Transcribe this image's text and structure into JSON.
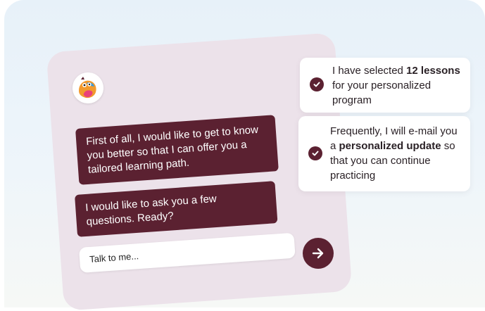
{
  "colors": {
    "accent": "#5b2131",
    "card": "#ece2ea",
    "background": "#e7f1f9"
  },
  "chat": {
    "avatar_icon": "bot-mascot-icon",
    "messages": [
      "First of all, I would like to get to know you better so that I can offer you a tailored learning path.",
      "I would like to ask you a few questions. Ready?"
    ],
    "input_placeholder": "Talk to me...",
    "send_icon": "arrow-right-icon"
  },
  "notifications": [
    {
      "icon": "check-circle-icon",
      "pre": "I have selected ",
      "bold": "12 lessons",
      "post": " for your personalized program"
    },
    {
      "icon": "check-circle-icon",
      "pre": "Frequently, I will e-mail you a ",
      "bold": "personalized update",
      "post": " so that you can continue practicing"
    }
  ]
}
